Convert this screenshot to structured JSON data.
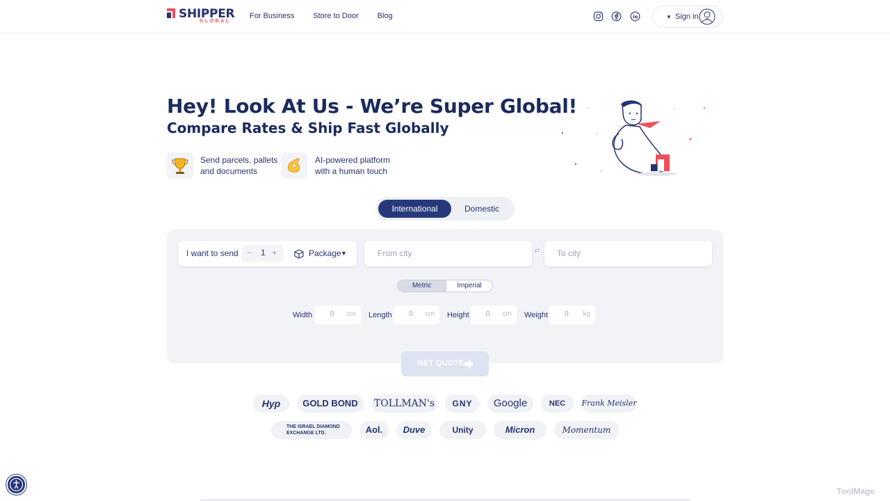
{
  "brand": {
    "name": "SHIPPER",
    "sub": "GLOBAL",
    "primary": "#25336f",
    "accent": "#ef4f5a"
  },
  "nav": [
    "For Business",
    "Store to Door",
    "Blog"
  ],
  "social": [
    "instagram-icon",
    "facebook-icon",
    "linkedin-icon"
  ],
  "signin": {
    "label": "Sign in"
  },
  "hero": {
    "title": "Hey! Look At Us - We’re Super Global!",
    "subtitle": "Compare Rates & Ship Fast Globally",
    "features": [
      {
        "icon": "trophy-icon",
        "line1": "Send parcels, pallets",
        "line2": "and documents"
      },
      {
        "icon": "ok-hand-icon",
        "line1": "AI-powered platform",
        "line2": "with a human touch"
      }
    ]
  },
  "mode_toggle": {
    "options": [
      "International",
      "Domestic"
    ],
    "active": "International"
  },
  "form": {
    "send_label": "I want to send",
    "quantity": "1",
    "minus": "−",
    "plus": "+",
    "type": "Package",
    "from_placeholder": "From city",
    "to_placeholder": "To city",
    "units": [
      "Metric",
      "Imperial"
    ],
    "active_unit": "Metric",
    "dimensions": [
      {
        "label": "Width",
        "value": "0",
        "unit": "cm"
      },
      {
        "label": "Length",
        "value": "0",
        "unit": "cm"
      },
      {
        "label": "Height",
        "value": "0",
        "unit": "cm"
      },
      {
        "label": "Weight",
        "value": "0",
        "unit": "kg"
      }
    ],
    "submit": "GET QUOTE"
  },
  "clients": {
    "row1": [
      "Hyp",
      "GOLD BOND",
      "TOLLMAN's",
      "GNY",
      "Google",
      "NEC",
      "Frank Meisler"
    ],
    "row2": [
      "THE ISRAEL DIAMOND EXCHANGE LTD.",
      "Aol.",
      "Duve",
      "Unity",
      "Micron",
      "Momentum"
    ]
  },
  "watermark": "ToolMage"
}
